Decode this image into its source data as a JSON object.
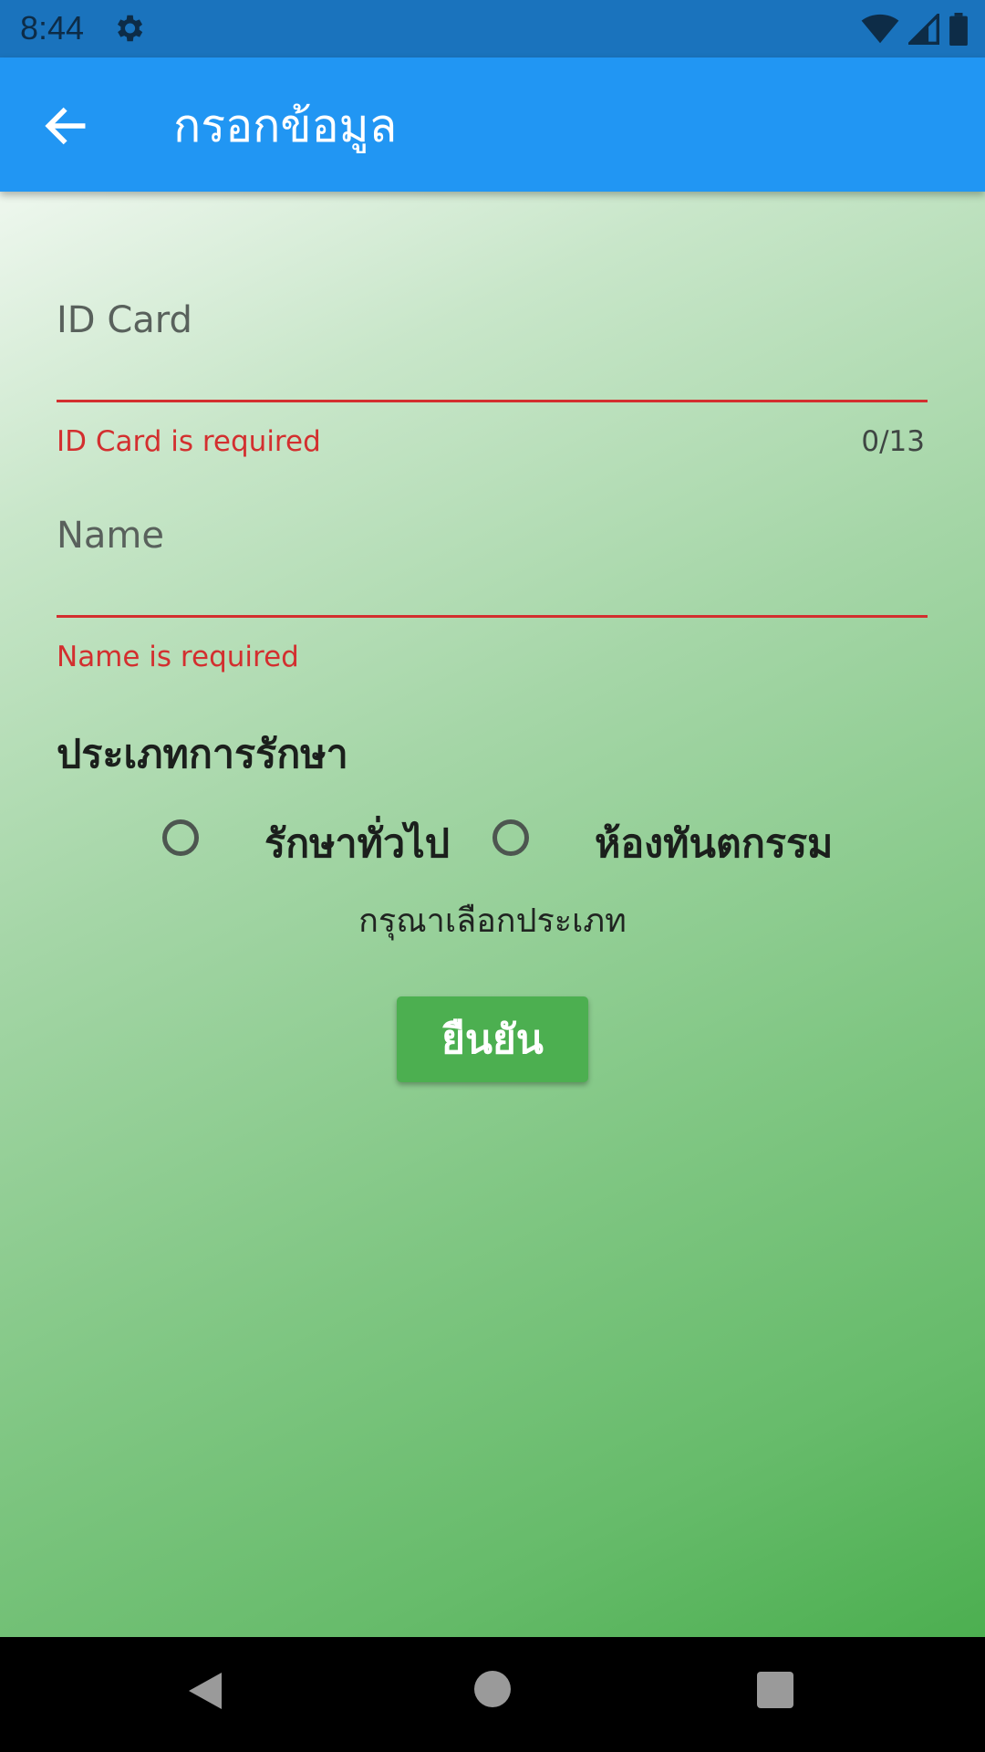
{
  "status_bar": {
    "time": "8:44"
  },
  "app_bar": {
    "title": "กรอกข้อมูล"
  },
  "form": {
    "id_card": {
      "label": "ID Card",
      "error": "ID Card is required",
      "counter": "0/13"
    },
    "name": {
      "label": "Name",
      "error": "Name is required"
    },
    "treatment_type": {
      "title": "ประเภทการรักษา",
      "options": [
        {
          "label": "รักษาทั่วไป",
          "selected": false
        },
        {
          "label": "ห้องทันตกรรม",
          "selected": false
        }
      ],
      "hint": "กรุณาเลือกประเภท"
    },
    "confirm_label": "ยืนยัน"
  },
  "colors": {
    "app_bar": "#2196f3",
    "status_bar": "#1a73bd",
    "error": "#d32f2f",
    "button": "#4caf50"
  }
}
